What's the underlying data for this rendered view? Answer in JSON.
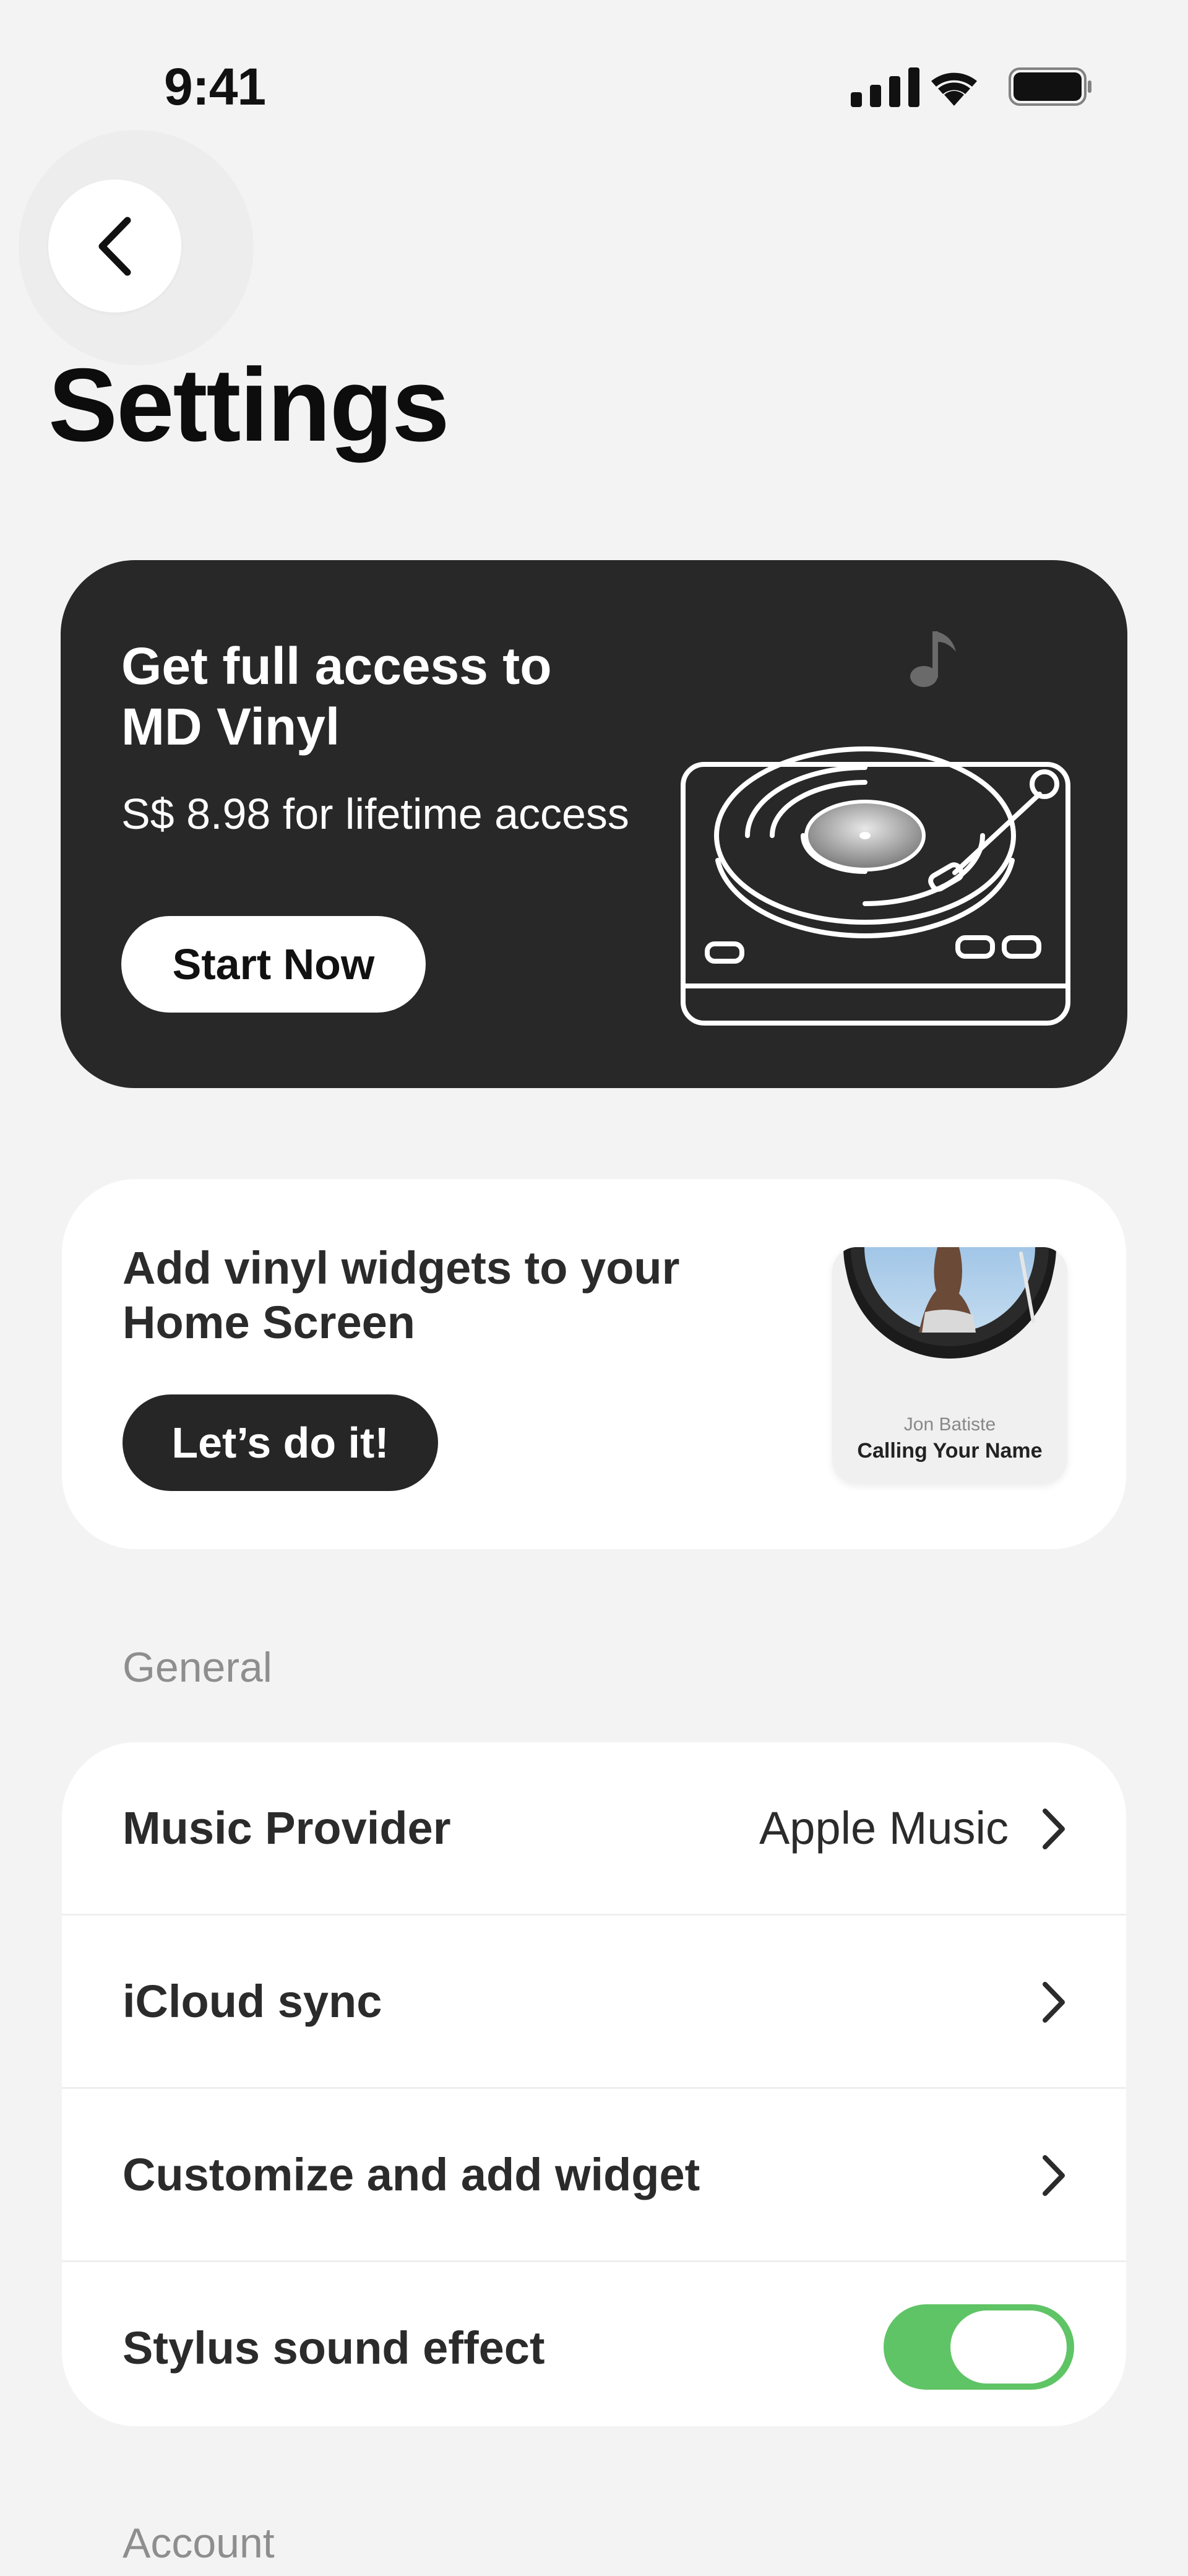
{
  "status_bar": {
    "time": "9:41"
  },
  "page_title": "Settings",
  "premium": {
    "title_line1": "Get full access to",
    "title_line2": "MD Vinyl",
    "price_text": "S$ 8.98 for lifetime access",
    "cta_label": "Start Now"
  },
  "widget_promo": {
    "title_line1": "Add vinyl widgets to your",
    "title_line2": "Home Screen",
    "cta_label": "Let’s do it!",
    "preview_artist": "Jon Batiste",
    "preview_song": "Calling Your Name"
  },
  "sections": {
    "general_label": "General",
    "account_label": "Account"
  },
  "general_rows": [
    {
      "label": "Music Provider",
      "value": "Apple Music"
    },
    {
      "label": "iCloud sync"
    },
    {
      "label": "Customize and add widget"
    },
    {
      "label": "Stylus sound effect",
      "toggle_on": true
    }
  ],
  "colors": {
    "background": "#f3f3f3",
    "premium_card": "#282828",
    "toggle_on": "#5fc465"
  }
}
